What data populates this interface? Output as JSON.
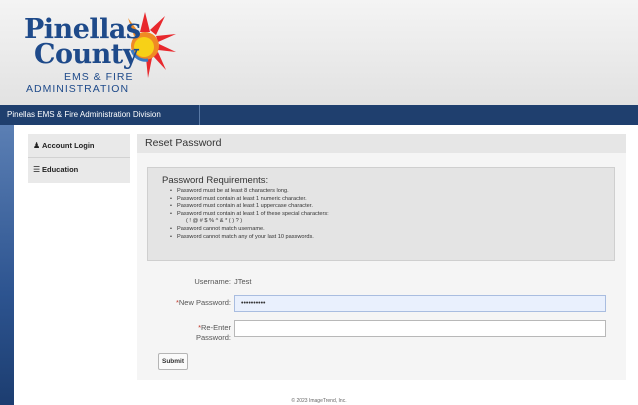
{
  "header": {
    "logo_line1": "Pinellas",
    "logo_line2": "County",
    "logo_line3": "EMS & FIRE",
    "logo_line4": "ADMINISTRATION"
  },
  "nav": {
    "title": "Pinellas EMS & Fire Administration Division"
  },
  "sidebar": {
    "items": [
      {
        "label": "Account Login",
        "icon": "user-icon"
      },
      {
        "label": "Education",
        "icon": "graduation-cap-icon"
      }
    ]
  },
  "main": {
    "title": "Reset Password",
    "requirements": {
      "title": "Password Requirements:",
      "items": [
        "Password must be at least 8 characters long.",
        "Password must contain at least 1 numeric character.",
        "Password must contain at least 1 uppercase character.",
        "Password must contain at least 1 of these special characters:",
        "( ! @ # $ % ^ & * ( ) ? )",
        "Password cannot match username.",
        "Password cannot match any of your last 10 passwords."
      ]
    },
    "form": {
      "username_label": "Username:",
      "username_value": "JTest",
      "required_mark": "*",
      "new_password_label": "New Password:",
      "new_password_value": "••••••••••",
      "reenter_label_1": "Re-Enter",
      "reenter_label_2": "Password:",
      "reenter_value": "",
      "submit_label": "Submit"
    }
  },
  "footer": {
    "copyright": "© 2023 ImageTrend, Inc."
  },
  "colors": {
    "nav_bg": "#1f3f6e",
    "logo_blue": "#1e4a8a",
    "logo_orange": "#f08a24",
    "logo_red": "#e8282d",
    "logo_yellow": "#f7d117"
  }
}
